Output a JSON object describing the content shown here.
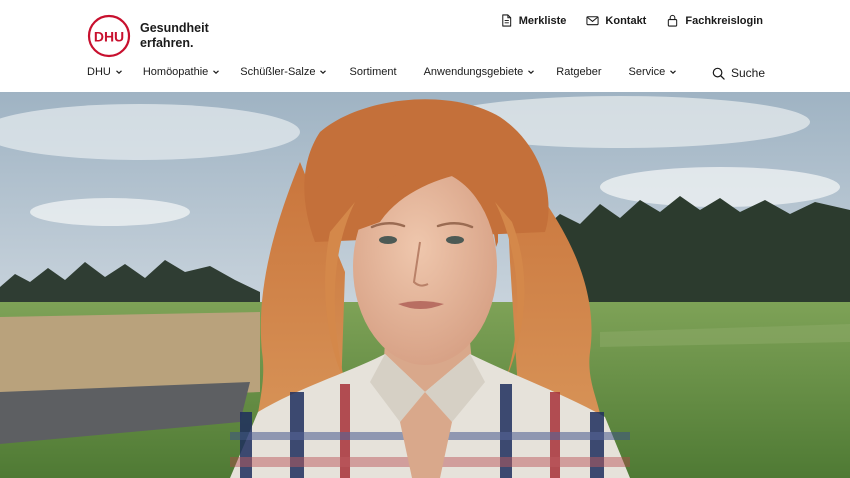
{
  "brand": {
    "logo_text": "DHU",
    "tagline_line1": "Gesundheit",
    "tagline_line2": "erfahren.",
    "brand_color": "#c8102e"
  },
  "utility_nav": [
    {
      "label": "Merkliste",
      "icon": "document-icon"
    },
    {
      "label": "Kontakt",
      "icon": "mail-icon"
    },
    {
      "label": "Fachkreislogin",
      "icon": "lock-icon"
    }
  ],
  "main_nav": [
    {
      "label": "DHU",
      "has_dropdown": true
    },
    {
      "label": "Homöopathie",
      "has_dropdown": true
    },
    {
      "label": "Schüßler-Salze",
      "has_dropdown": true
    },
    {
      "label": "Sortiment",
      "has_dropdown": false
    },
    {
      "label": "Anwendungsgebiete",
      "has_dropdown": true
    },
    {
      "label": "Ratgeber",
      "has_dropdown": false
    },
    {
      "label": "Service",
      "has_dropdown": true
    }
  ],
  "search": {
    "label": "Suche",
    "icon": "search-icon"
  },
  "hero": {
    "image": "woman-with-red-hair-in-field"
  }
}
